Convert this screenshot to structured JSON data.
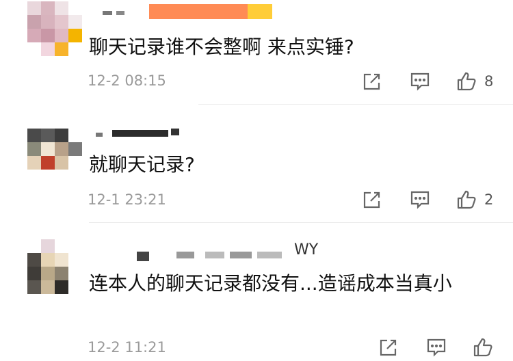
{
  "comments": [
    {
      "text": "聊天记录谁不会整啊 来点实锤?",
      "time": "12-2 08:15",
      "likes": "8"
    },
    {
      "text": "就聊天记录?",
      "time": "12-1 23:21",
      "likes": "2"
    },
    {
      "name_visible": "WY",
      "text": "连本人的聊天记录都没有...造谣成本当真小",
      "time": "12-2 11:21",
      "likes": ""
    }
  ],
  "icons": {
    "share": "share-icon",
    "reply": "comment-icon",
    "like": "thumbs-up-icon"
  }
}
